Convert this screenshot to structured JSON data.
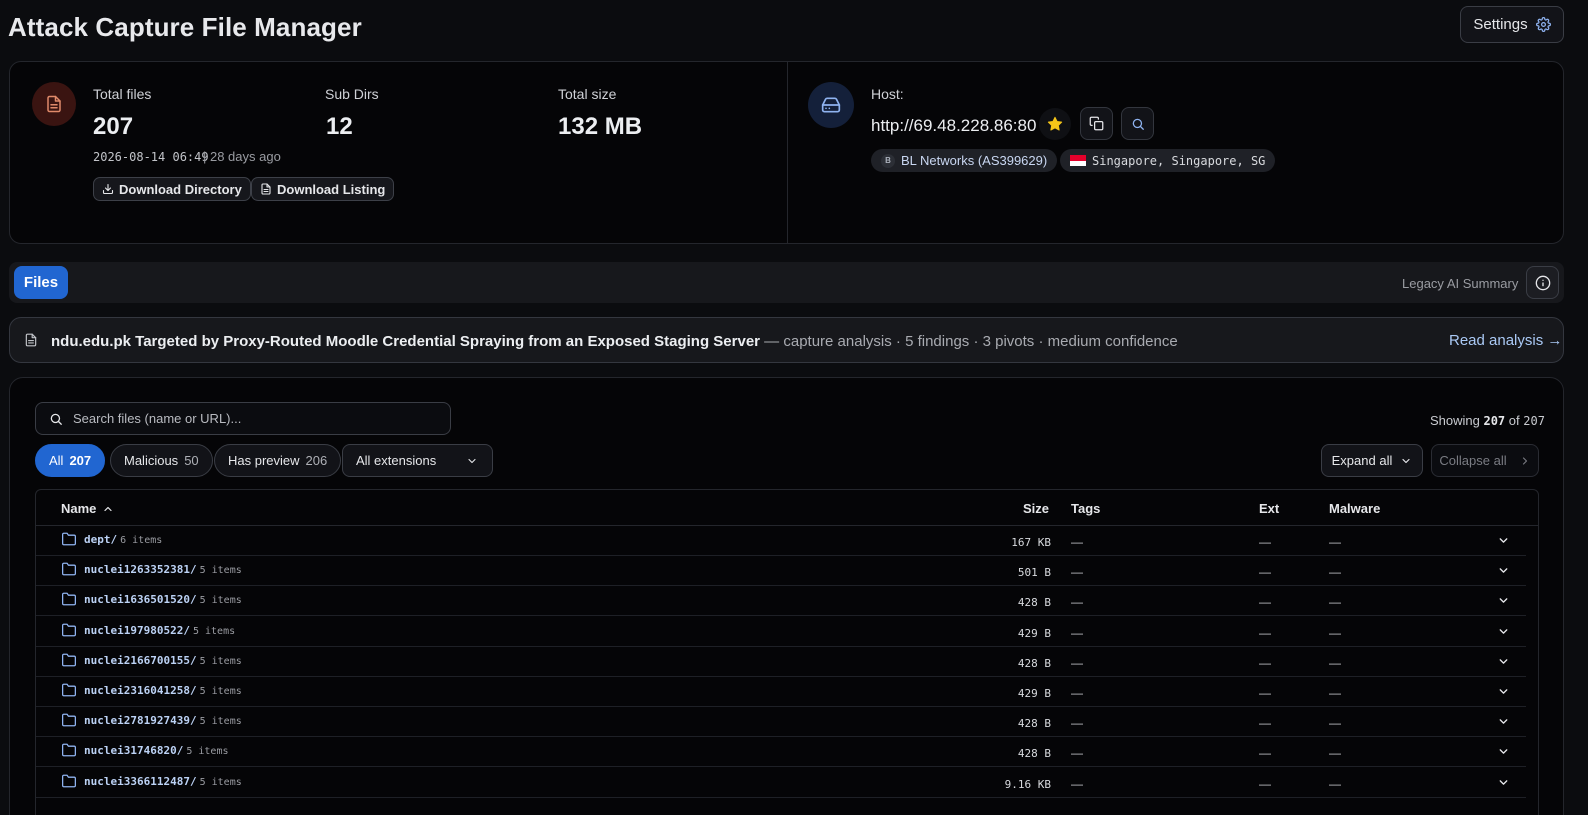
{
  "header": {
    "title": "Attack Capture File Manager",
    "settings_label": "Settings"
  },
  "stats": {
    "total_files_label": "Total files",
    "total_files_value": "207",
    "sub_dirs_label": "Sub Dirs",
    "sub_dirs_value": "12",
    "total_size_label": "Total size",
    "total_size_value": "132 MB",
    "timestamp": "2026-08-14 06:49",
    "relative_time": "| 28 days ago",
    "download_directory_label": "Download Directory",
    "download_listing_label": "Download Listing"
  },
  "host": {
    "label": "Host:",
    "url": "http://69.48.228.86:80",
    "asn_badge_letter": "B",
    "asn_label": "BL Networks (AS399629)",
    "location_label": "Singapore, Singapore, SG"
  },
  "tabs": {
    "files_label": "Files",
    "legacy_label": "Legacy AI Summary"
  },
  "analysis": {
    "title": "ndu.edu.pk Targeted by Proxy-Routed Moodle Credential Spraying from an Exposed Staging Server",
    "meta": " — capture analysis · 5 findings · 3 pivots · medium confidence",
    "read_label": "Read analysis →"
  },
  "search": {
    "placeholder": "Search files (name or URL)..."
  },
  "showing": {
    "prefix": "Showing ",
    "count": "207",
    "middle": " of ",
    "total": "207"
  },
  "filters": {
    "all_label": "All",
    "all_count": "207",
    "malicious_label": "Malicious",
    "malicious_count": "50",
    "preview_label": "Has preview",
    "preview_count": "206",
    "extensions_label": "All extensions"
  },
  "actions": {
    "expand_label": "Expand all",
    "collapse_label": "Collapse all"
  },
  "table": {
    "headers": {
      "name": "Name",
      "size": "Size",
      "tags": "Tags",
      "ext": "Ext",
      "malware": "Malware"
    },
    "rows": [
      {
        "name": "dept/",
        "items": "6 items",
        "size": "167 KB",
        "tags": "—",
        "ext": "—",
        "malware": "—"
      },
      {
        "name": "nuclei1263352381/",
        "items": "5 items",
        "size": "501 B",
        "tags": "—",
        "ext": "—",
        "malware": "—"
      },
      {
        "name": "nuclei1636501520/",
        "items": "5 items",
        "size": "428 B",
        "tags": "—",
        "ext": "—",
        "malware": "—"
      },
      {
        "name": "nuclei197980522/",
        "items": "5 items",
        "size": "429 B",
        "tags": "—",
        "ext": "—",
        "malware": "—"
      },
      {
        "name": "nuclei2166700155/",
        "items": "5 items",
        "size": "428 B",
        "tags": "—",
        "ext": "—",
        "malware": "—"
      },
      {
        "name": "nuclei2316041258/",
        "items": "5 items",
        "size": "429 B",
        "tags": "—",
        "ext": "—",
        "malware": "—"
      },
      {
        "name": "nuclei2781927439/",
        "items": "5 items",
        "size": "428 B",
        "tags": "—",
        "ext": "—",
        "malware": "—"
      },
      {
        "name": "nuclei31746820/",
        "items": "5 items",
        "size": "428 B",
        "tags": "—",
        "ext": "—",
        "malware": "—"
      },
      {
        "name": "nuclei3366112487/",
        "items": "5 items",
        "size": "9.16 KB",
        "tags": "—",
        "ext": "—",
        "malware": "—"
      }
    ]
  },
  "colors": {
    "accent": "#2166d1",
    "background": "#0b0c0f",
    "star": "#f5c518",
    "file_badge_icon": "#e08a6a",
    "host_badge_icon": "#8fb3f0"
  },
  "icons": [
    "gear-icon",
    "document-icon",
    "drive-icon",
    "star-icon",
    "copy-icon",
    "search-icon",
    "download-icon",
    "info-icon",
    "folder-icon",
    "chevron-down-icon",
    "chevron-up-icon",
    "chevron-right-icon"
  ]
}
